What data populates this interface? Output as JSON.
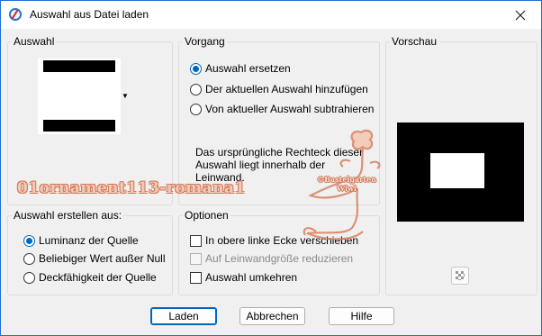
{
  "window": {
    "title": "Auswahl aus Datei laden",
    "close_icon": "close-icon",
    "app_icon": "paintshop-icon"
  },
  "groups": {
    "auswahl": {
      "label": "Auswahl"
    },
    "vorgang": {
      "label": "Vorgang",
      "options": [
        "Auswahl ersetzen",
        "Der aktuellen Auswahl hinzufügen",
        "Von aktueller Auswahl subtrahieren"
      ],
      "selected": "Auswahl ersetzen",
      "description": "Das ursprüngliche Rechteck dieser Auswahl liegt innerhalb der Leinwand."
    },
    "vorschau": {
      "label": "Vorschau",
      "tool_icon": "checkerboard-icon"
    },
    "erstellen": {
      "label": "Auswahl erstellen aus:",
      "options": [
        "Luminanz der Quelle",
        "Beliebiger Wert außer Null",
        "Deckfähigkeit der Quelle"
      ],
      "selected": "Luminanz der Quelle"
    },
    "optionen": {
      "label": "Optionen",
      "checkboxes": [
        {
          "label": "In obere linke Ecke verschieben",
          "checked": false,
          "enabled": true
        },
        {
          "label": "Auf Leinwandgröße reduzieren",
          "checked": false,
          "enabled": false
        },
        {
          "label": "Auswahl umkehren",
          "checked": false,
          "enabled": true
        }
      ]
    }
  },
  "watermark": {
    "text": "01ornament113-romana1",
    "deco_text_1": "©Bastelgarten",
    "deco_text_2": "Wiwi"
  },
  "buttons": {
    "ok": "Laden",
    "cancel": "Abbrechen",
    "help": "Hilfe"
  },
  "colors": {
    "accent": "#0067c0",
    "watermark": "#d27a5a"
  }
}
